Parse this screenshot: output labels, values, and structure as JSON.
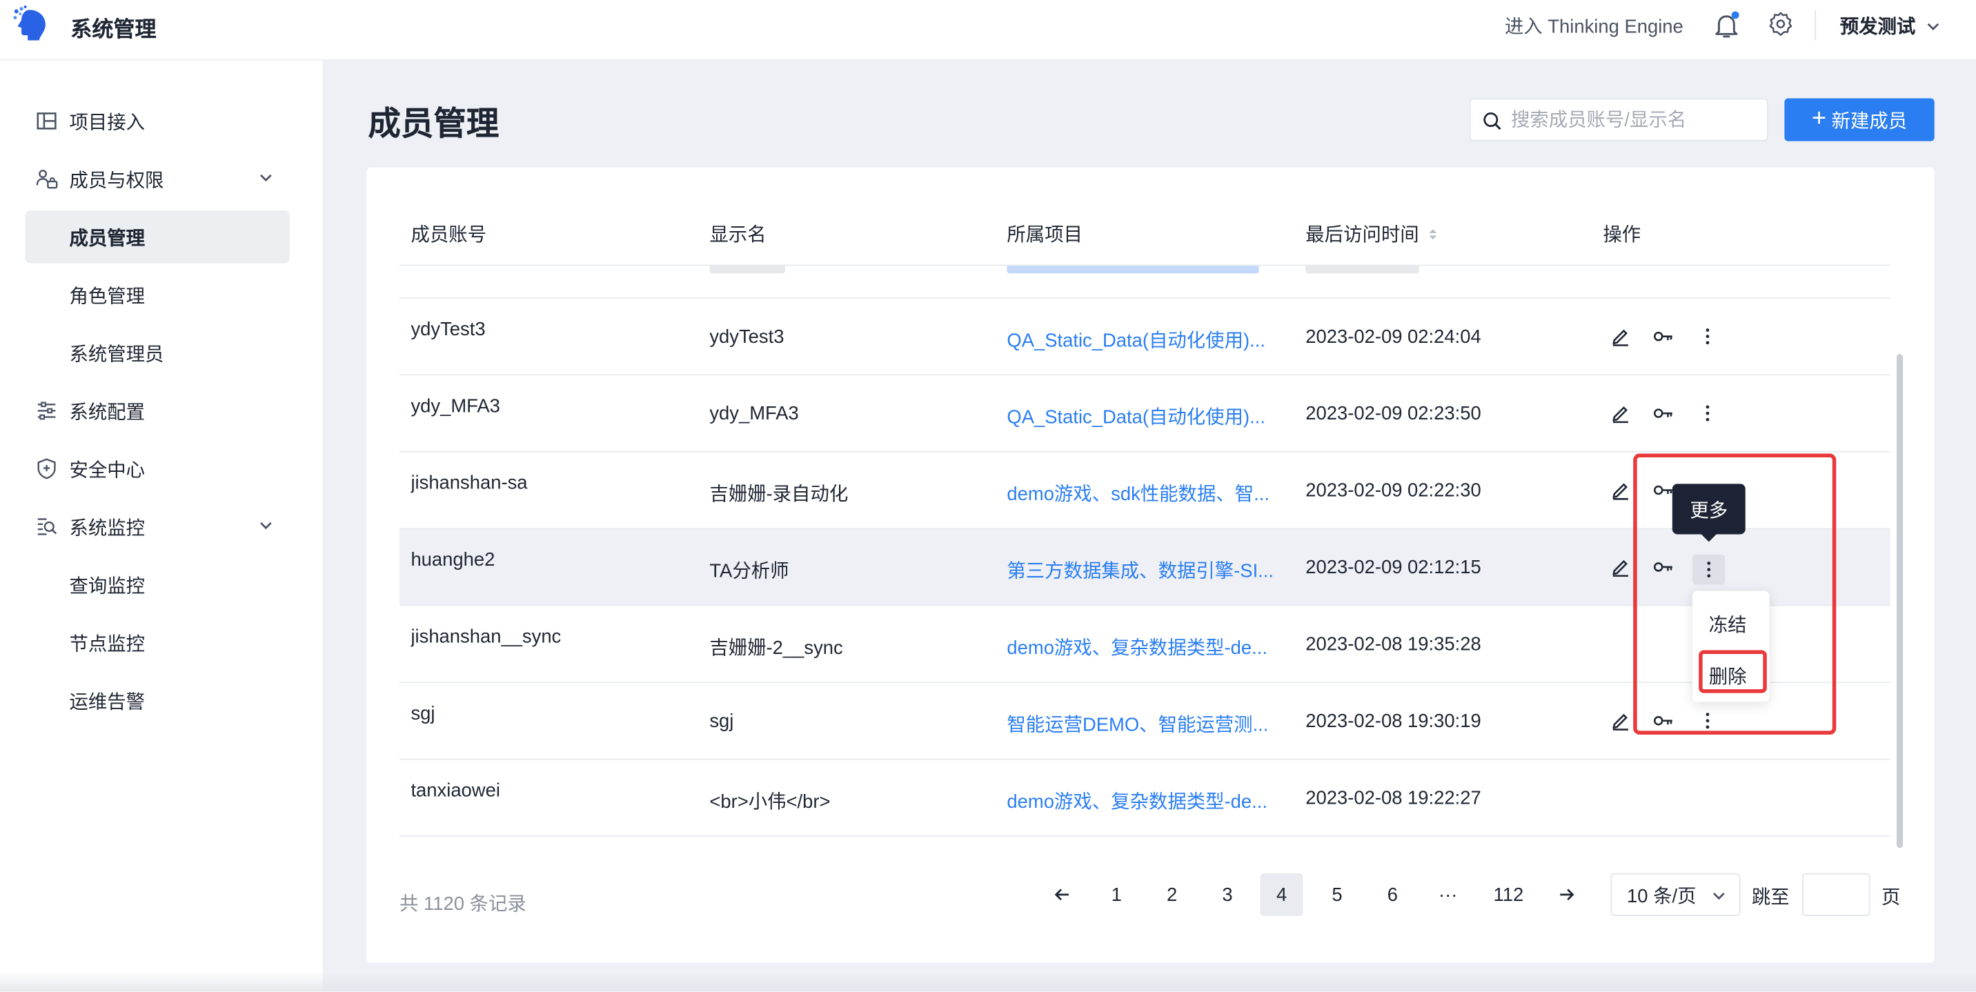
{
  "app": {
    "title": "系统管理",
    "enter_te": "进入 Thinking Engine",
    "env": "预发测试"
  },
  "sidebar": {
    "items": [
      {
        "label": "项目接入",
        "icon": "layout-icon"
      },
      {
        "label": "成员与权限",
        "icon": "users-icon",
        "expanded": true
      },
      {
        "label": "成员管理",
        "active": true
      },
      {
        "label": "角色管理"
      },
      {
        "label": "系统管理员"
      },
      {
        "label": "系统配置",
        "icon": "sliders-icon"
      },
      {
        "label": "安全中心",
        "icon": "shield-icon"
      },
      {
        "label": "系统监控",
        "icon": "monitor-search-icon",
        "expanded": true
      },
      {
        "label": "查询监控"
      },
      {
        "label": "节点监控"
      },
      {
        "label": "运维告警"
      }
    ]
  },
  "page": {
    "title": "成员管理",
    "search_placeholder": "搜索成员账号/显示名",
    "new_button": "新建成员"
  },
  "table": {
    "headers": [
      "成员账号",
      "显示名",
      "所属项目",
      "最后访问时间",
      "操作"
    ],
    "rows": [
      {
        "account": "ydyTest3",
        "display": "ydyTest3",
        "project": "QA_Static_Data(自动化使用)...",
        "time": "2023-02-09 02:24:04"
      },
      {
        "account": "ydy_MFA3",
        "display": "ydy_MFA3",
        "project": "QA_Static_Data(自动化使用)...",
        "time": "2023-02-09 02:23:50"
      },
      {
        "account": "jishanshan-sa",
        "display": "吉姗姗-录自动化",
        "project": "demo游戏、sdk性能数据、智...",
        "time": "2023-02-09 02:22:30"
      },
      {
        "account": "huanghe2",
        "display": "TA分析师",
        "project": "第三方数据集成、数据引擎-SI...",
        "time": "2023-02-09 02:12:15"
      },
      {
        "account": "jishanshan__sync",
        "display": "吉姗姗-2__sync",
        "project": "demo游戏、复杂数据类型-de...",
        "time": "2023-02-08 19:35:28"
      },
      {
        "account": "sgj",
        "display": "sgj",
        "project": "智能运营DEMO、智能运营测...",
        "time": "2023-02-08 19:30:19"
      },
      {
        "account": "tanxiaowei",
        "display": "<br>小伟</br>",
        "project": "demo游戏、复杂数据类型-de...",
        "time": "2023-02-08 19:22:27"
      }
    ]
  },
  "pagination": {
    "total": "共 1120 条记录",
    "pages": [
      "1",
      "2",
      "3",
      "4",
      "5",
      "6",
      "···",
      "112"
    ],
    "current": "4",
    "page_size": "10 条/页",
    "jump_label": "跳至",
    "page_label": "页"
  },
  "overlay": {
    "tooltip": "更多",
    "menu": [
      "冻结",
      "删除"
    ]
  },
  "colors": {
    "accent": "#2a7ef2",
    "highlight": "#e9393a",
    "tooltip_bg": "#1d2334"
  }
}
